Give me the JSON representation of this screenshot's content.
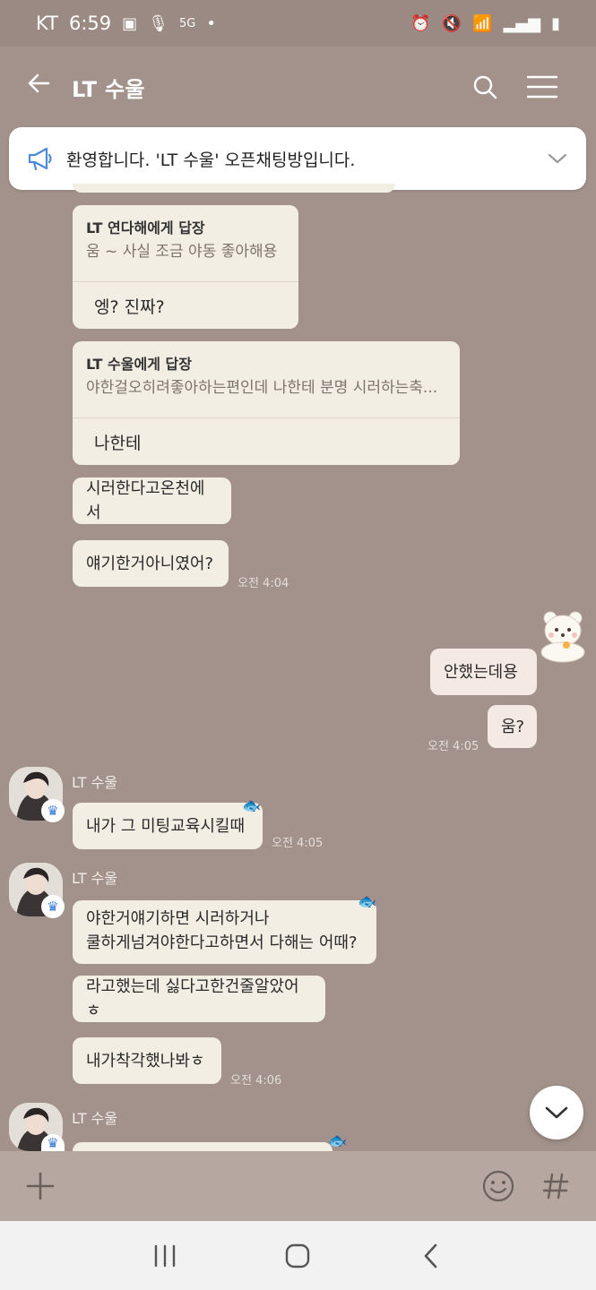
{
  "status": {
    "carrier": "KT",
    "time": "6:59",
    "network": "5G"
  },
  "header": {
    "title": "LT 수울"
  },
  "notice": {
    "text": "환영합니다. 'LT 수울' 오픈채팅방입니다."
  },
  "messages": {
    "r1_name": "LT 연다해에게 답장",
    "r1_quote": "움 ~ 사실 조금 야동 좋아해용",
    "r1_body": "엥? 진짜?",
    "r2_name": "LT 수울에게 답장",
    "r2_quote": "야한걸오히려좋아하는편인데 나한테 분명 시러하는축...",
    "r2_body": "나한테",
    "m1": "시러한다고온천에서",
    "m2": "얘기한거아니였어?",
    "t1": "오전 4:04",
    "mine1": "안했는데용",
    "mine2": "움?",
    "t2": "오전 4:05",
    "sender": "LT 수울",
    "m3": "내가  그 미팅교육시킬때",
    "t3": "오전 4:05",
    "m4a": "야한거얘기하면 시러하거나",
    "m4b": "쿨하게넘겨야한다고하면서 다해는 어때?",
    "m5": "라고했는데 싫다고한건줄알았어ㅎ",
    "m6": "내가착각했나봐ㅎ",
    "t4": "오전 4:06"
  },
  "colors": {
    "background": "#a2928b",
    "bubble": "#f3eee4",
    "my_bubble": "#f5e9e4",
    "accent": "#3e7bd6"
  }
}
